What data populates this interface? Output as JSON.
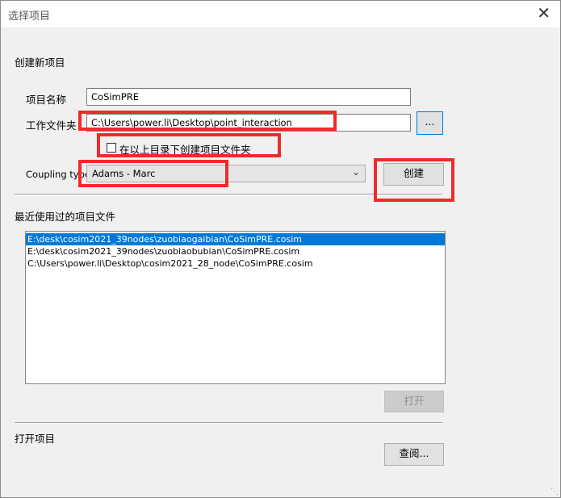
{
  "window": {
    "title": "选择项目",
    "close_glyph": "✕"
  },
  "create": {
    "section_label": "创建新项目",
    "name_label": "项目名称",
    "name_value": "CoSimPRE",
    "folder_label": "工作文件夹",
    "folder_value": "C:\\Users\\power.li\\Desktop\\point_interaction",
    "browse_label": "...",
    "checkbox_label": "在以上目录下创建项目文件夹",
    "checkbox_checked": false,
    "coupling_label": "Coupling type",
    "coupling_value": "Adams - Marc",
    "create_button": "创建"
  },
  "recent": {
    "section_label": "最近使用过的项目文件",
    "items": [
      "E:\\desk\\cosim2021_39nodes\\zuobiaogaibian\\CoSimPRE.cosim",
      "E:\\desk\\cosim2021_39nodes\\zuobiaobubian\\CoSimPRE.cosim",
      "C:\\Users\\power.li\\Desktop\\cosim2021_28_node\\CoSimPRE.cosim"
    ],
    "selected_index": 0,
    "open_button": "打开"
  },
  "open": {
    "section_label": "打开项目",
    "browse_button": "查阅..."
  },
  "icons": {
    "close": "close-icon",
    "dropdown": "chevron-down-icon",
    "resize": "resize-grip-icon"
  },
  "colors": {
    "highlight": "#ee2a2a",
    "selection": "#0078d7",
    "dialog_bg": "#f0f0f0"
  }
}
